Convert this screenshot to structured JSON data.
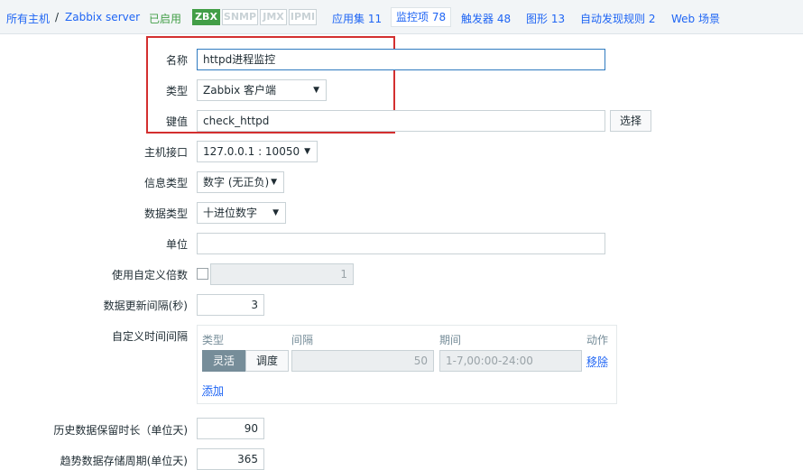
{
  "breadcrumb": {
    "all_hosts": "所有主机",
    "separator": "/",
    "host": "Zabbix server"
  },
  "status": "已启用",
  "availability": [
    "ZBX",
    "SNMP",
    "JMX",
    "IPMI"
  ],
  "tabs": {
    "applications": "应用集 11",
    "items": "监控项 78",
    "triggers": "触发器 48",
    "graphs": "图形 13",
    "discovery": "自动发现规则 2",
    "web": "Web 场景"
  },
  "form": {
    "name_label": "名称",
    "name_value": "httpd进程监控",
    "type_label": "类型",
    "type_value": "Zabbix 客户端",
    "key_label": "键值",
    "key_value": "check_httpd",
    "select_button": "选择",
    "interface_label": "主机接口",
    "interface_value": "127.0.0.1 : 10050",
    "info_type_label": "信息类型",
    "info_type_value": "数字 (无正负)",
    "data_type_label": "数据类型",
    "data_type_value": "十进位数字",
    "units_label": "单位",
    "units_value": "",
    "multiplier_label": "使用自定义倍数",
    "multiplier_value": "1",
    "interval_label": "数据更新间隔(秒)",
    "interval_value": "3",
    "custom_intervals_label": "自定义时间间隔",
    "history_label": "历史数据保留时长（单位天)",
    "history_value": "90",
    "trends_label": "趋势数据存储周期(单位天)",
    "trends_value": "365"
  },
  "custom_intervals": {
    "col_type": "类型",
    "col_interval": "间隔",
    "col_period": "期间",
    "col_action": "动作",
    "flexible": "灵活",
    "scheduling": "调度",
    "interval_value": "50",
    "period_value": "1-7,00:00-24:00",
    "remove": "移除",
    "add": "添加"
  },
  "colors": {
    "accent": "#1f65f4",
    "enabled": "#429e47",
    "highlight": "#d32f2f"
  }
}
